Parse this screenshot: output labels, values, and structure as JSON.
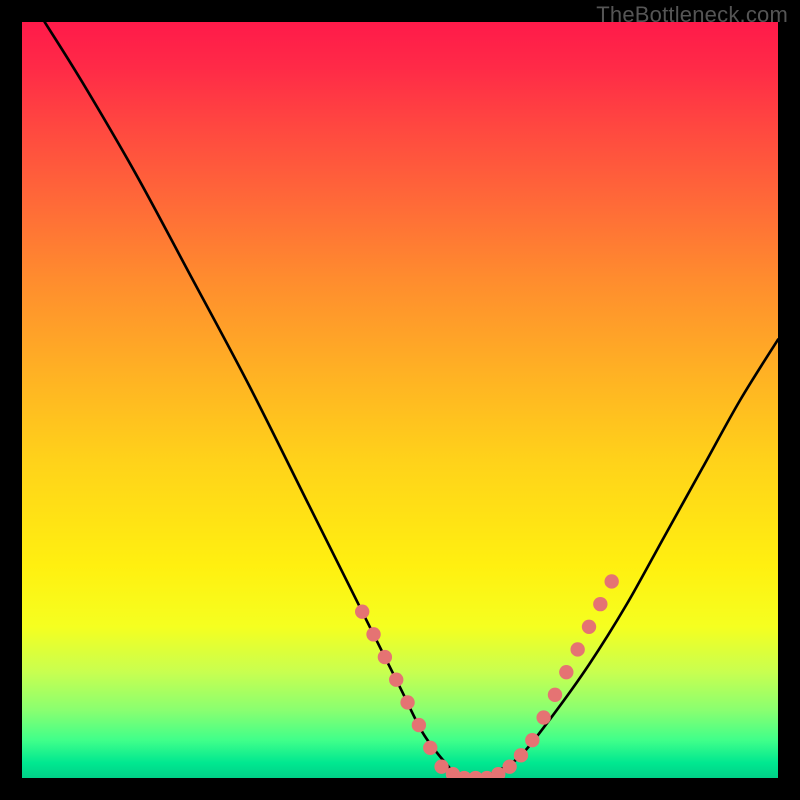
{
  "watermark": "TheBottleneck.com",
  "chart_data": {
    "type": "line",
    "title": "",
    "xlabel": "",
    "ylabel": "",
    "xlim": [
      0,
      100
    ],
    "ylim": [
      0,
      100
    ],
    "grid": false,
    "legend": false,
    "series": [
      {
        "name": "bottleneck-curve",
        "x": [
          3,
          8,
          15,
          22,
          30,
          38,
          45,
          50,
          53,
          56,
          58,
          60,
          63,
          66,
          70,
          75,
          80,
          85,
          90,
          95,
          100
        ],
        "y": [
          100,
          92,
          80,
          67,
          52,
          36,
          22,
          12,
          6,
          2,
          0,
          0,
          1,
          3,
          8,
          15,
          23,
          32,
          41,
          50,
          58
        ]
      }
    ],
    "markers": [
      {
        "name": "left-dots",
        "x": [
          45,
          46.5,
          48,
          49.5,
          51,
          52.5,
          54
        ],
        "y": [
          22,
          19,
          16,
          13,
          10,
          7,
          4
        ]
      },
      {
        "name": "trough-dots",
        "x": [
          55.5,
          57,
          58.5,
          60,
          61.5,
          63,
          64.5,
          66
        ],
        "y": [
          1.5,
          0.5,
          0,
          0,
          0,
          0.5,
          1.5,
          3
        ]
      },
      {
        "name": "right-dots",
        "x": [
          67.5,
          69,
          70.5,
          72,
          73.5,
          75,
          76.5,
          78
        ],
        "y": [
          5,
          8,
          11,
          14,
          17,
          20,
          23,
          26
        ]
      }
    ],
    "gradient_colors": {
      "top": "#ff1a4a",
      "mid_upper": "#ff8c2e",
      "mid": "#fff010",
      "mid_lower": "#8aff70",
      "bottom": "#00d088"
    },
    "marker_color": "#e57373"
  }
}
